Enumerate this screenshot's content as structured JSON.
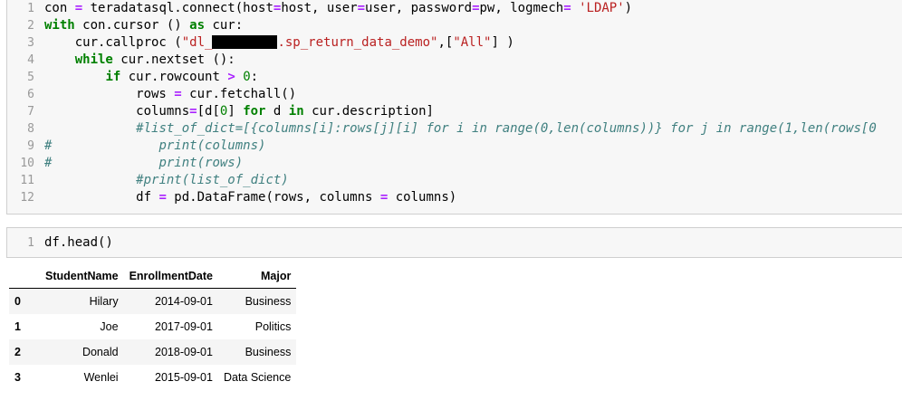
{
  "cell1": {
    "line_numbers": [
      "1",
      "2",
      "3",
      "4",
      "5",
      "6",
      "7",
      "8",
      "9",
      "10",
      "11",
      "12"
    ],
    "l1": {
      "a": "con ",
      "b": "=",
      "c": " teradatasql.connect(host",
      "d": "=",
      "e": "host, user",
      "f": "=",
      "g": "user, password",
      "h": "=",
      "i": "pw, logmech",
      "j": "=",
      "k": " ",
      "l": "'LDAP'",
      "m": ")"
    },
    "l2": {
      "a": "with",
      "b": " con.cursor () ",
      "c": "as",
      "d": " cur:"
    },
    "l3": {
      "a": "    cur.callproc (",
      "b": "\"dl_",
      "c": ".sp_return_data_demo\"",
      "d": ",[",
      "e": "\"All\"",
      "f": "] )"
    },
    "l4": {
      "a": "    ",
      "b": "while",
      "c": " cur.nextset ():"
    },
    "l5": {
      "a": "        ",
      "b": "if",
      "c": " cur.rowcount ",
      "d": ">",
      "e": " ",
      "f": "0",
      "g": ":"
    },
    "l6": {
      "a": "            rows ",
      "b": "=",
      "c": " cur.fetchall()"
    },
    "l7": {
      "a": "            columns",
      "b": "=",
      "c": "[d[",
      "d": "0",
      "e": "] ",
      "f": "for",
      "g": " d ",
      "h": "in",
      "i": " cur.description]"
    },
    "l8": {
      "a": "            ",
      "b": "#list_of_dict=[{columns[i]:rows[j][i] for i in range(0,len(columns))} for j in range(1,len(rows[0"
    },
    "l9": {
      "a": "#",
      "b": "              print(columns)"
    },
    "l10": {
      "a": "#",
      "b": "              print(rows)"
    },
    "l11": {
      "a": "            ",
      "b": "#print(list_of_dict)"
    },
    "l12": {
      "a": "            df ",
      "b": "=",
      "c": " pd.DataFrame(rows, columns ",
      "d": "=",
      "e": " columns)"
    }
  },
  "cell2": {
    "line_number": "1",
    "code": "df.head()"
  },
  "dataframe": {
    "columns": [
      "",
      "StudentName",
      "EnrollmentDate",
      "Major"
    ],
    "rows": [
      {
        "index": "0",
        "name": "Hilary",
        "date": "2014-09-01",
        "major": "Business"
      },
      {
        "index": "1",
        "name": "Joe",
        "date": "2017-09-01",
        "major": "Politics"
      },
      {
        "index": "2",
        "name": "Donald",
        "date": "2018-09-01",
        "major": "Business"
      },
      {
        "index": "3",
        "name": "Wenlei",
        "date": "2015-09-01",
        "major": "Data Science"
      }
    ]
  }
}
